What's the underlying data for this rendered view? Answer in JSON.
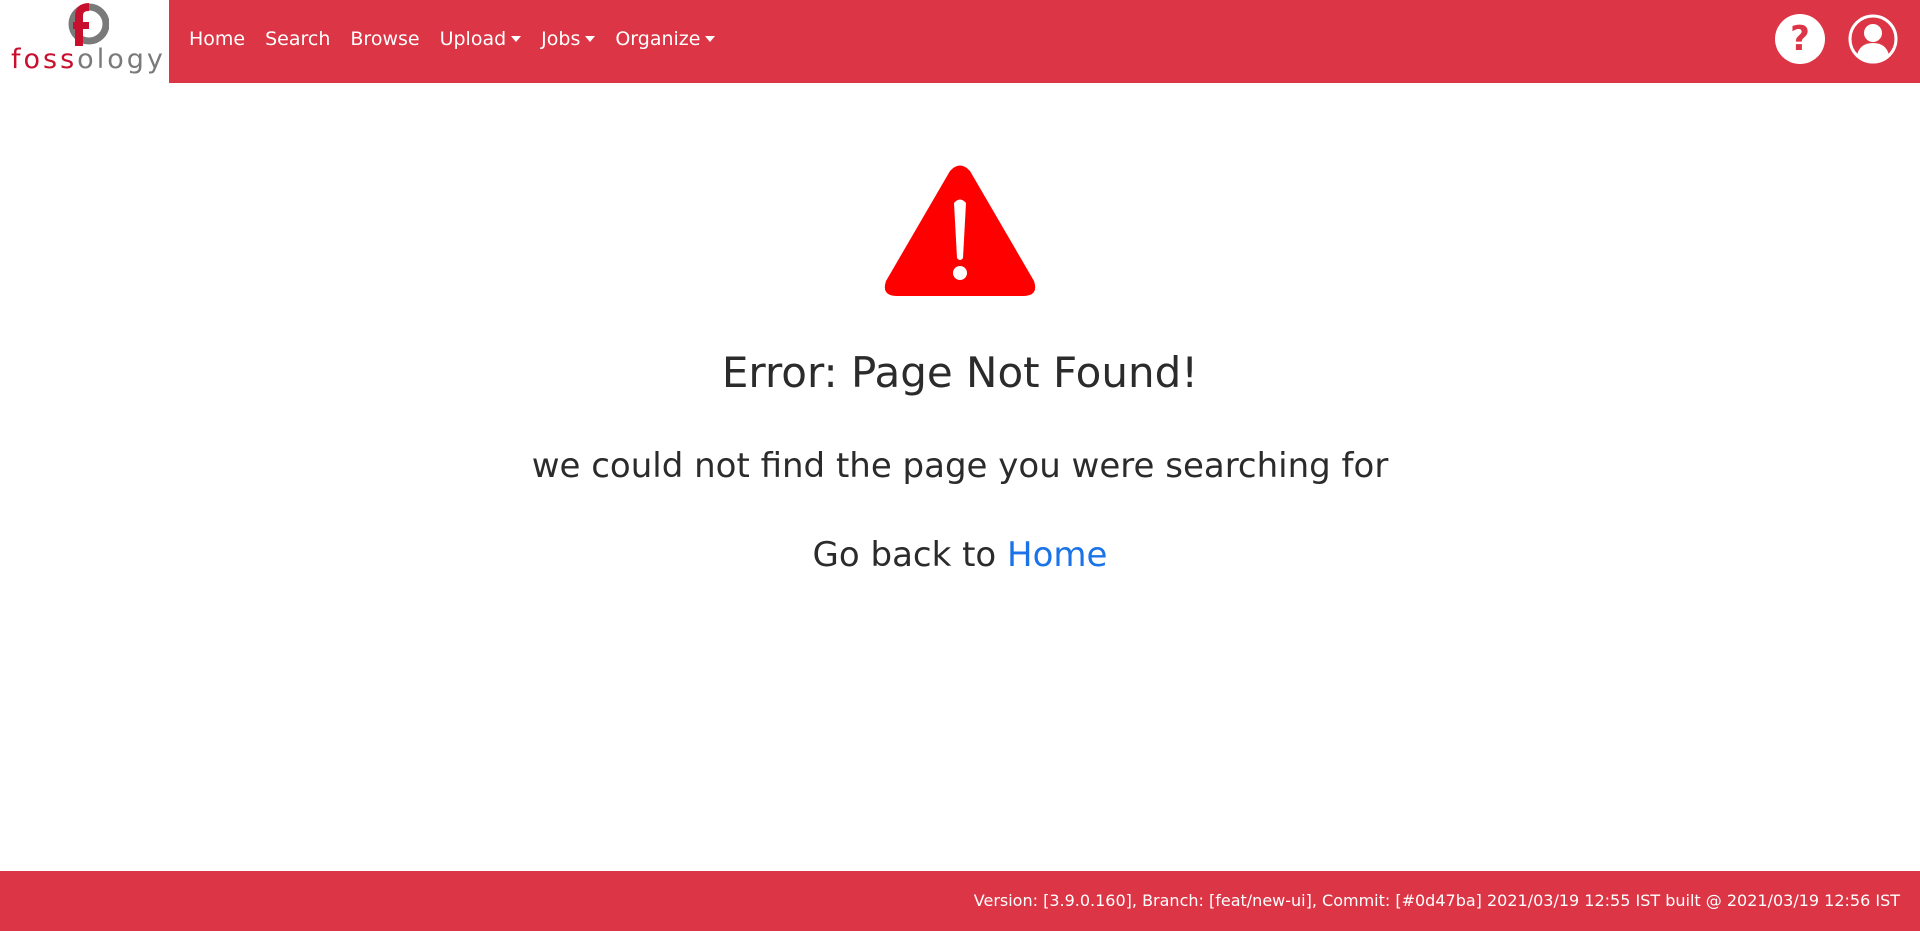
{
  "header": {
    "logo": {
      "text_a": "foss",
      "text_b": "ology"
    },
    "nav": [
      {
        "label": "Home"
      },
      {
        "label": "Search"
      },
      {
        "label": "Browse"
      },
      {
        "label": "Upload",
        "dropdown": true
      },
      {
        "label": "Jobs",
        "dropdown": true
      },
      {
        "label": "Organize",
        "dropdown": true
      }
    ],
    "help_label": "?",
    "icons": {
      "help": "question-icon",
      "user": "user-icon"
    }
  },
  "main": {
    "icon": "warning-icon",
    "title": "Error: Page Not Found!",
    "message": "we could not find the page you were searching for",
    "go_back_prefix": "Go back to ",
    "home_link": "Home"
  },
  "footer": {
    "version_text": "Version: [3.9.0.160], Branch: [feat/new-ui], Commit: [#0d47ba] 2021/03/19 12:55 IST built @ 2021/03/19 12:56 IST"
  },
  "colors": {
    "brand_red": "#dc3545",
    "logo_red": "#c8102e",
    "logo_gray": "#7a7a7a",
    "warning_red": "#ff0000",
    "link_blue": "#1a73e8"
  }
}
